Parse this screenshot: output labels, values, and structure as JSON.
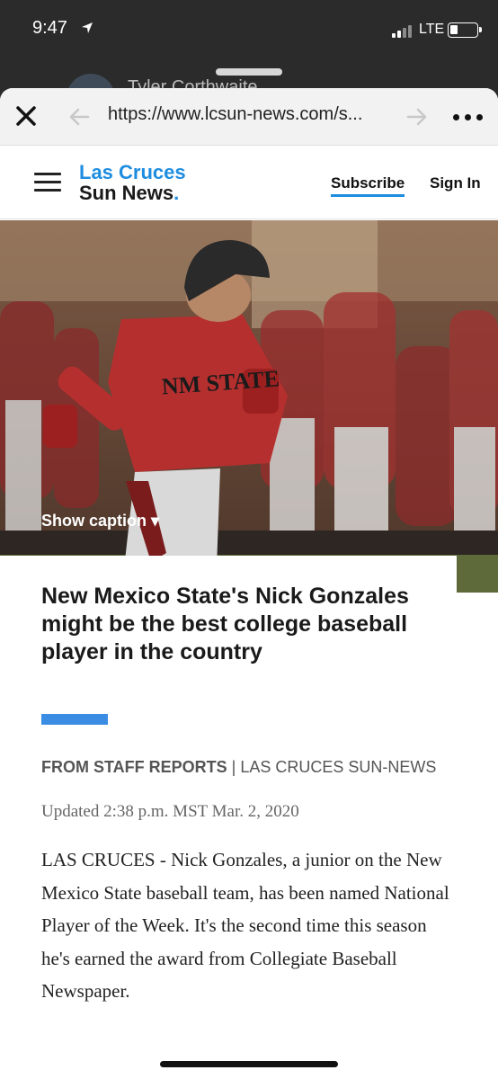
{
  "status_bar": {
    "time": "9:47",
    "network": "LTE",
    "icons": [
      "location-arrow-icon",
      "signal-icon",
      "battery-icon"
    ]
  },
  "background_sheet": {
    "name": "Tyler Corthwaite"
  },
  "browser": {
    "url": "https://www.lcsun-news.com/s...",
    "icons": [
      "close-icon",
      "back-arrow-icon",
      "forward-arrow-icon",
      "more-icon"
    ]
  },
  "site": {
    "logo_line1": "Las Cruces",
    "logo_line2": "Sun News",
    "logo_dot": ".",
    "subscribe_label": "Subscribe",
    "signin_label": "Sign In",
    "accent_color": "#1e8de0"
  },
  "hero": {
    "caption_toggle": "Show caption ▾",
    "jersey_text": "NM STATE"
  },
  "article": {
    "headline": "New Mexico State's Nick Gonzales might be the best college baseball player in the country",
    "byline_staff": "FROM STAFF REPORTS",
    "byline_sep": " |",
    "byline_source": "  LAS CRUCES SUN-NEWS",
    "updated": "Updated 2:38 p.m. MST Mar. 2, 2020",
    "body": "LAS CRUCES - Nick Gonzales, a junior on the New Mexico State baseball team, has been named National Player of the Week. It's the second time this season he's earned the award from Collegiate Baseball Newspaper."
  }
}
